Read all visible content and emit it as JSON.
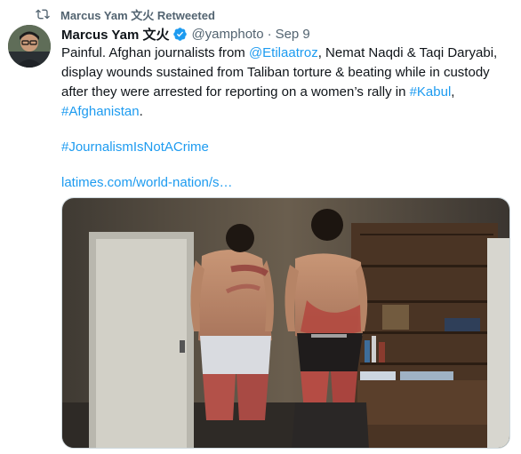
{
  "retweet": {
    "icon": "retweet-icon",
    "label": "Marcus Yam 文火 Retweeted"
  },
  "tweet": {
    "author_name": "Marcus Yam 文火",
    "verified_icon": "verified-badge-icon",
    "handle": "@yamphoto",
    "separator": "·",
    "date": "Sep 9",
    "text_1": "Painful. Afghan journalists from ",
    "mention": "@Etilaatroz",
    "text_2": ", Nemat Naqdi & Taqi Daryabi,",
    "line_2": "display wounds sustained from Taliban torture & beating while in custody",
    "line_3": "after they were arrested for reporting on a women’s rally in ",
    "hashtag_kabul": "#Kabul",
    "line_3_end": ",",
    "hashtag_afghanistan": "#Afghanistan",
    "line_4_end": ".",
    "hashtag_journalism": "#JournalismIsNotACrime",
    "url": "latimes.com/world-nation/s…"
  },
  "colors": {
    "link": "#1d9bf0",
    "secondary": "#536471",
    "text": "#0f1419"
  }
}
